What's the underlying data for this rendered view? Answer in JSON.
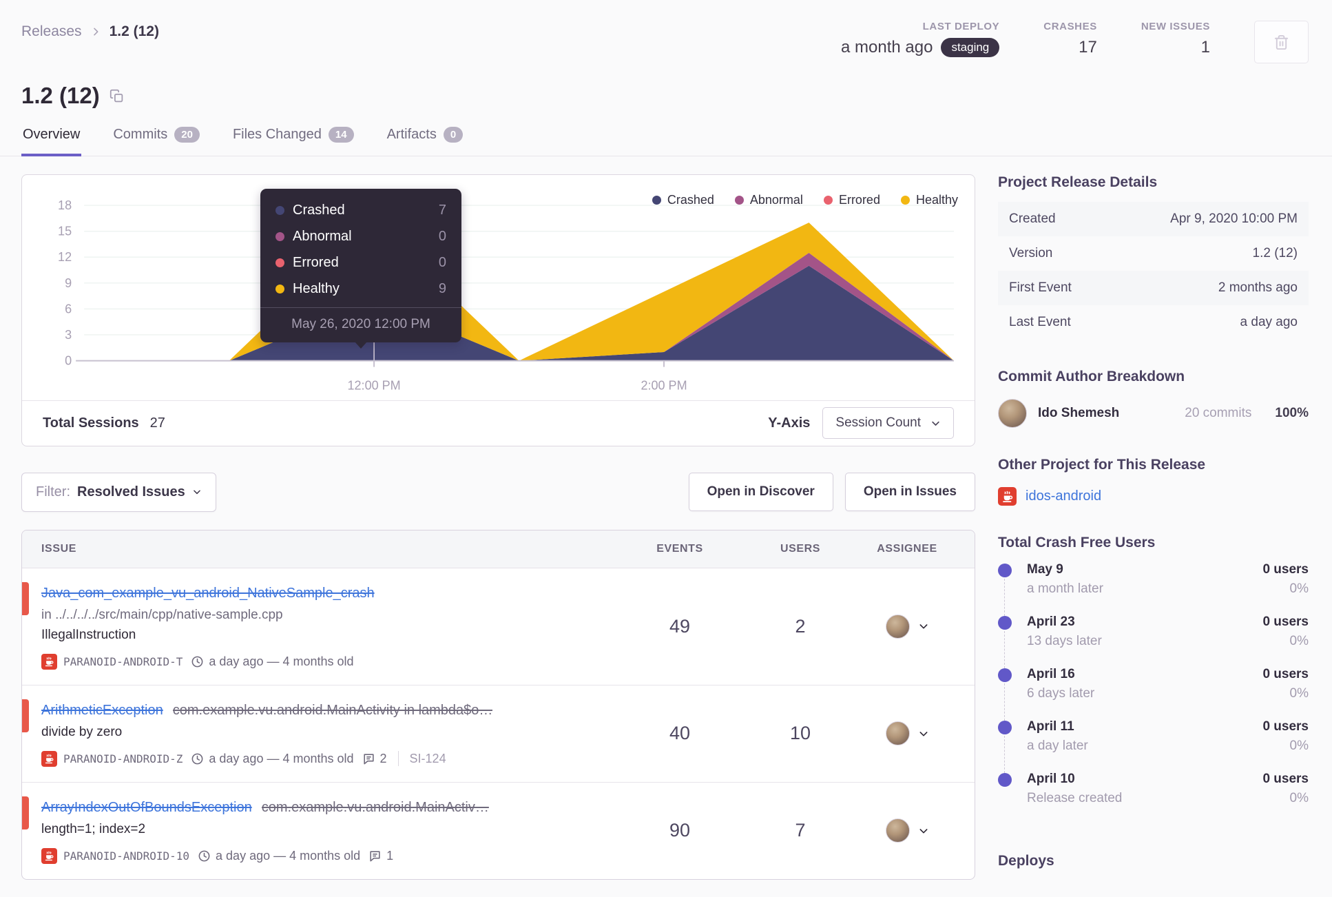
{
  "page": {
    "background": "#fafafb",
    "accent": "#6c5fc7",
    "link_color": "#3d74db",
    "error_level_color": "#e8584a"
  },
  "breadcrumb": {
    "root": "Releases",
    "current": "1.2 (12)"
  },
  "header": {
    "last_deploy": {
      "label": "LAST DEPLOY",
      "value": "a month ago",
      "env": "staging"
    },
    "crashes": {
      "label": "CRASHES",
      "value": "17"
    },
    "new_issues": {
      "label": "NEW ISSUES",
      "value": "1"
    }
  },
  "title": "1.2 (12)",
  "tabs": {
    "overview": "Overview",
    "commits": "Commits",
    "commits_badge": "20",
    "files": "Files Changed",
    "files_badge": "14",
    "artifacts": "Artifacts",
    "artifacts_badge": "0"
  },
  "chart_data": {
    "type": "area",
    "stacked": true,
    "x": [
      "10:00 AM",
      "11:00 AM",
      "12:00 PM",
      "1:00 PM",
      "2:00 PM",
      "3:00 PM",
      "4:00 PM"
    ],
    "series": [
      {
        "name": "Crashed",
        "color": "#444674",
        "values": [
          0,
          0,
          7,
          0,
          1,
          11,
          0
        ]
      },
      {
        "name": "Abnormal",
        "color": "#a35488",
        "values": [
          0,
          0,
          0,
          0,
          0,
          1.5,
          0
        ]
      },
      {
        "name": "Errored",
        "color": "#e9626e",
        "values": [
          0,
          0,
          0,
          0,
          0,
          0,
          0
        ]
      },
      {
        "name": "Healthy",
        "color": "#f2b712",
        "values": [
          0,
          0,
          9,
          0,
          7,
          3.5,
          0
        ]
      }
    ],
    "ylim": [
      0,
      18
    ],
    "yticks": [
      0,
      3,
      6,
      9,
      12,
      15,
      18
    ],
    "x_tick_labels": [
      "12:00 PM",
      "2:00 PM"
    ],
    "x_tick_index": [
      2,
      4
    ],
    "hover_index": 2,
    "grid": true,
    "legend_position": "top-right"
  },
  "tooltip": {
    "rows": [
      {
        "label": "Crashed",
        "value": "7"
      },
      {
        "label": "Abnormal",
        "value": "0"
      },
      {
        "label": "Errored",
        "value": "0"
      },
      {
        "label": "Healthy",
        "value": "9"
      }
    ],
    "footer": "May 26, 2020 12:00 PM"
  },
  "chart_footer": {
    "sessions_label": "Total Sessions",
    "sessions_value": "27",
    "yaxis_label": "Y-Axis",
    "yaxis_value": "Session Count"
  },
  "toolbar": {
    "filter_label": "Filter:",
    "filter_value": "Resolved Issues",
    "discover": "Open in Discover",
    "open_issues": "Open in Issues"
  },
  "issues": {
    "columns": {
      "issue": "ISSUE",
      "events": "EVENTS",
      "users": "USERS",
      "assignee": "ASSIGNEE"
    },
    "rows": [
      {
        "title": "Java_com_example_vu_android_NativeSample_crash",
        "location": "in ../../../../src/main/cpp/native-sample.cpp",
        "message": "IllegalInstruction",
        "project": "PARANOID-ANDROID-T",
        "age": "a day ago — 4 months old",
        "events": "49",
        "users": "2"
      },
      {
        "title": "ArithmeticException",
        "culprit": "com.example.vu.android.MainActivity in lambda$o…",
        "message": "divide by zero",
        "project": "PARANOID-ANDROID-Z",
        "age": "a day ago — 4 months old",
        "comments": "2",
        "annotation": "SI-124",
        "events": "40",
        "users": "10"
      },
      {
        "title": "ArrayIndexOutOfBoundsException",
        "culprit": "com.example.vu.android.MainActiv…",
        "message": "length=1; index=2",
        "project": "PARANOID-ANDROID-10",
        "age": "a day ago — 4 months old",
        "comments": "1",
        "events": "90",
        "users": "7"
      }
    ]
  },
  "sidebar": {
    "details": {
      "heading": "Project Release Details",
      "rows": [
        {
          "label": "Created",
          "value": "Apr 9, 2020 10:00 PM"
        },
        {
          "label": "Version",
          "value": "1.2 (12)"
        },
        {
          "label": "First Event",
          "value": "2 months ago"
        },
        {
          "label": "Last Event",
          "value": "a day ago"
        }
      ]
    },
    "authors": {
      "heading": "Commit Author Breakdown",
      "name": "Ido Shemesh",
      "commits": "20 commits",
      "percent": "100%"
    },
    "other_project": {
      "heading": "Other Project for This Release",
      "name": "idos-android"
    },
    "crash_free": {
      "heading": "Total Crash Free Users",
      "items": [
        {
          "date": "May 9",
          "when": "a month later",
          "users": "0 users",
          "percent": "0%"
        },
        {
          "date": "April 23",
          "when": "13 days later",
          "users": "0 users",
          "percent": "0%"
        },
        {
          "date": "April 16",
          "when": "6 days later",
          "users": "0 users",
          "percent": "0%"
        },
        {
          "date": "April 11",
          "when": "a day later",
          "users": "0 users",
          "percent": "0%"
        },
        {
          "date": "April 10",
          "when": "Release created",
          "users": "0 users",
          "percent": "0%"
        }
      ]
    },
    "deploys_heading": "Deploys"
  }
}
